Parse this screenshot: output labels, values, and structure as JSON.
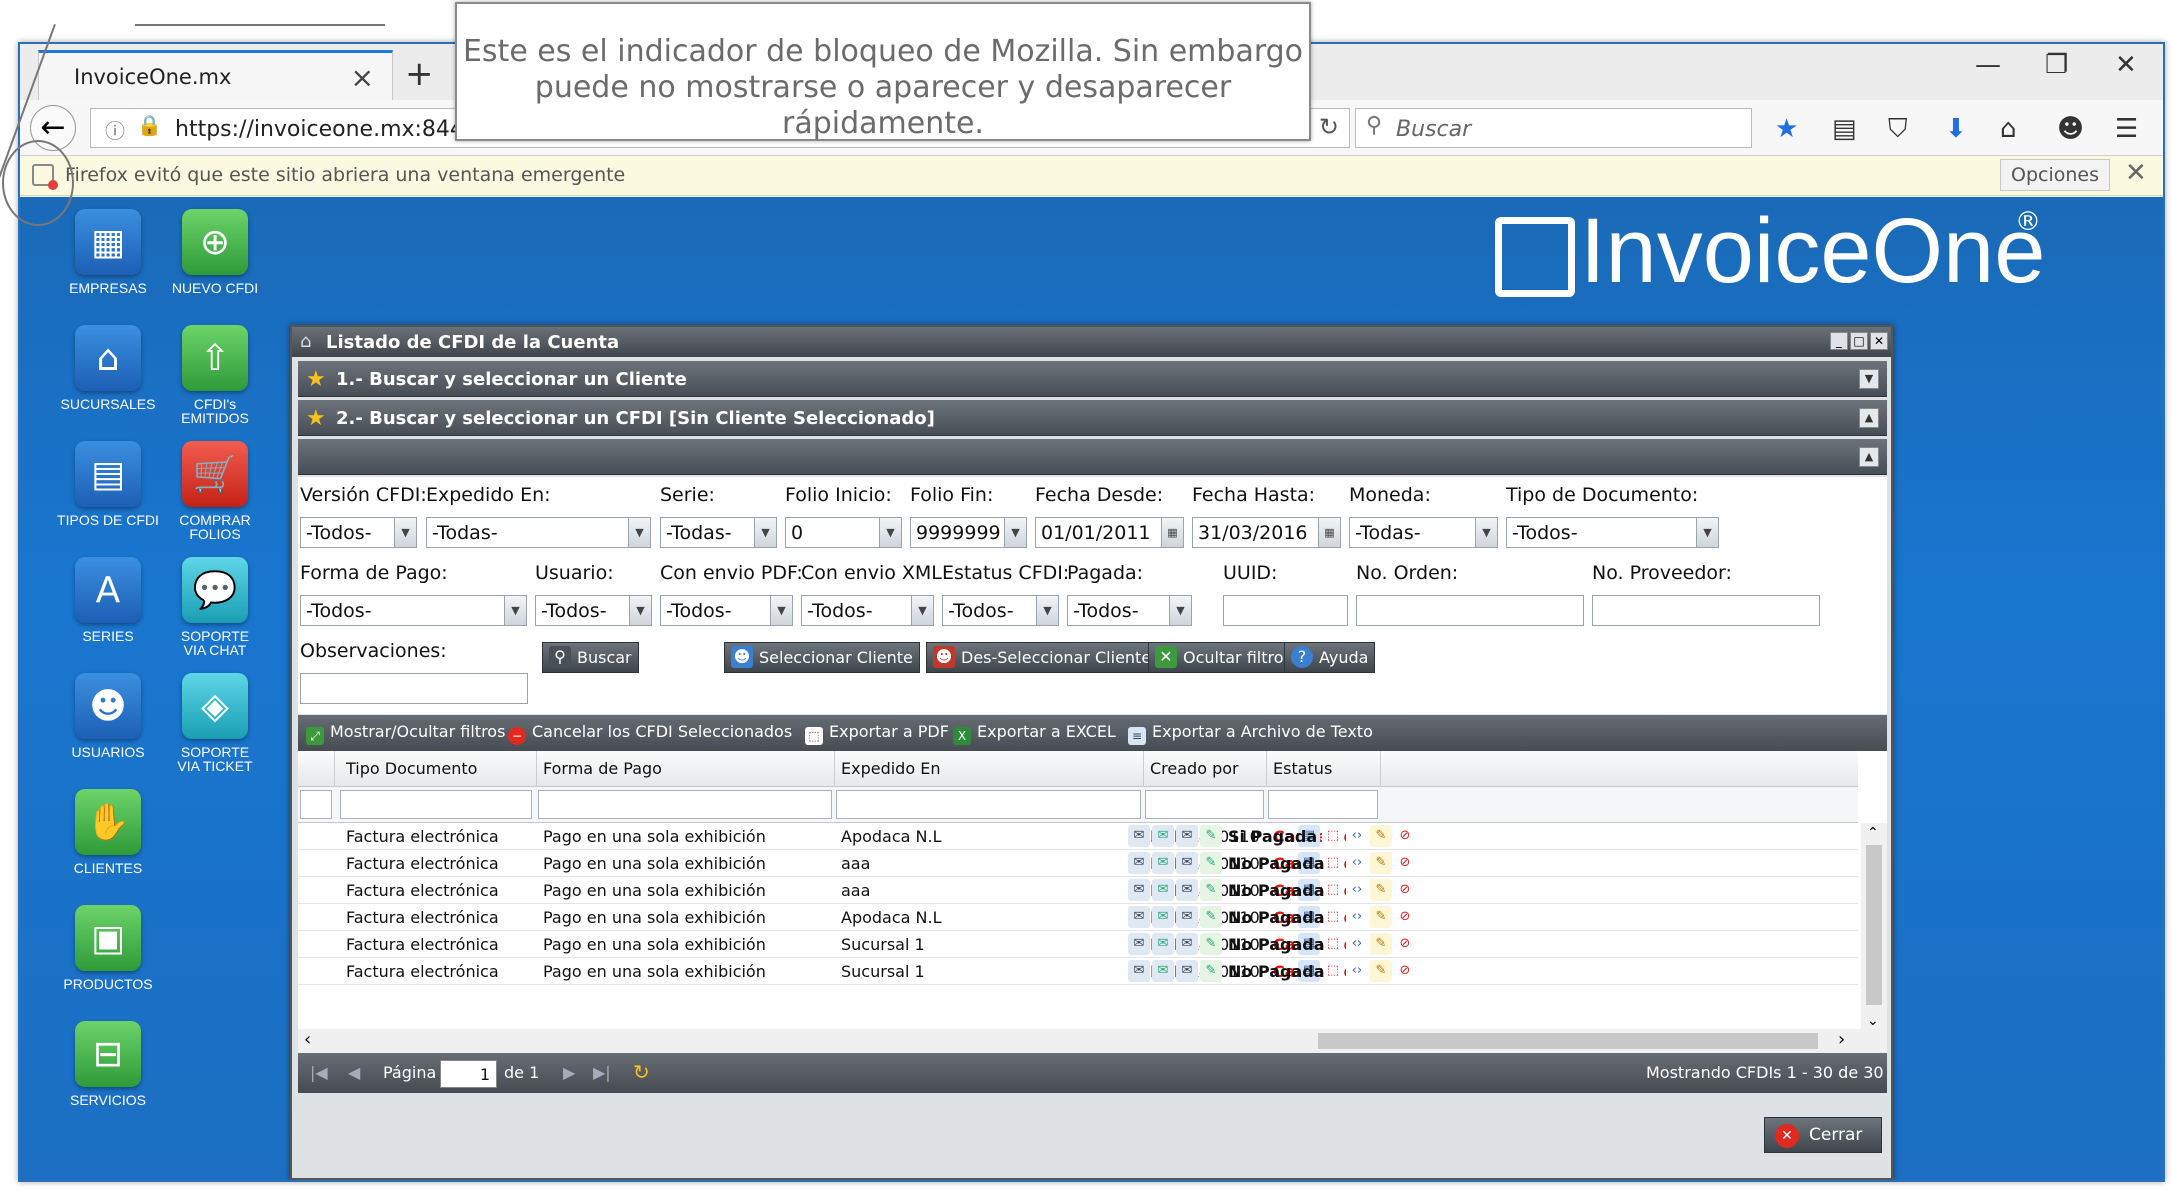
{
  "browser": {
    "tab_title": "InvoiceOne.mx",
    "url": "https://invoiceone.mx:8443/apl",
    "search_placeholder": "Buscar",
    "notification_text": "Firefox evitó que este sitio abriera una ventana emergente",
    "notification_options": "Opciones"
  },
  "annotation": {
    "line1": "Este es el indicador de bloqueo de Mozilla. Sin embargo",
    "line2": "puede no mostrarse o aparecer y desaparecer rápidamente."
  },
  "logo": {
    "text": "InvoiceOne",
    "reg": "®"
  },
  "desktop_icons": {
    "empresas": "EMPRESAS",
    "nuevo_cfdi": "NUEVO CFDI",
    "sucursales": "SUCURSALES",
    "cfdis_emitidos_1": "CFDI's",
    "cfdis_emitidos_2": "EMITIDOS",
    "tipos_cfdi": "TIPOS DE CFDI",
    "comprar_1": "COMPRAR",
    "comprar_2": "FOLIOS",
    "series": "SERIES",
    "soporte_chat_1": "SOPORTE",
    "soporte_chat_2": "VIA CHAT",
    "usuarios": "USUARIOS",
    "soporte_ticket_1": "SOPORTE",
    "soporte_ticket_2": "VIA TICKET",
    "clientes": "CLIENTES",
    "productos": "PRODUCTOS",
    "servicios": "SERVICIOS"
  },
  "window": {
    "title": "Listado de CFDI de la Cuenta",
    "panel1": "1.- Buscar y seleccionar un Cliente",
    "panel2": "2.- Buscar y seleccionar un CFDI [Sin Cliente Seleccionado]",
    "filters": {
      "version_lbl": "Versión CFDI:",
      "version_val": "-Todos-",
      "expedido_lbl": "Expedido En:",
      "expedido_val": "-Todas-",
      "serie_lbl": "Serie:",
      "serie_val": "-Todas-",
      "folio_ini_lbl": "Folio Inicio:",
      "folio_ini_val": "0",
      "folio_fin_lbl": "Folio Fin:",
      "folio_fin_val": "9999999",
      "fecha_desde_lbl": "Fecha Desde:",
      "fecha_desde_val": "01/01/2011",
      "fecha_hasta_lbl": "Fecha Hasta:",
      "fecha_hasta_val": "31/03/2016",
      "moneda_lbl": "Moneda:",
      "moneda_val": "-Todas-",
      "tipo_doc_lbl": "Tipo de Documento:",
      "tipo_doc_val": "-Todos-",
      "forma_pago_lbl": "Forma de Pago:",
      "forma_pago_val": "-Todos-",
      "usuario_lbl": "Usuario:",
      "usuario_val": "-Todos-",
      "envio_pdf_lbl": "Con envio PDF:",
      "envio_pdf_val": "-Todos-",
      "envio_xml_lbl": "Con envio XML:",
      "envio_xml_val": "-Todos-",
      "estatus_lbl": "Estatus CFDI:",
      "estatus_val": "-Todos-",
      "pagada_lbl": "Pagada:",
      "pagada_val": "-Todos-",
      "uuid_lbl": "UUID:",
      "orden_lbl": "No. Orden:",
      "proveedor_lbl": "No. Proveedor:",
      "observaciones_lbl": "Observaciones:"
    },
    "buttons": {
      "buscar": "Buscar",
      "seleccionar": "Seleccionar Cliente",
      "deseleccionar": "Des-Seleccionar Cliente",
      "ocultar": "Ocultar filtros",
      "ayuda": "Ayuda"
    },
    "toolbar": {
      "mostrar": "Mostrar/Ocultar filtros",
      "cancelar": "Cancelar los CFDI Seleccionados",
      "pdf": "Exportar a PDF",
      "excel": "Exportar a EXCEL",
      "texto": "Exportar a Archivo de Texto"
    },
    "columns": {
      "tipo": "Tipo Documento",
      "forma": "Forma de Pago",
      "expedido": "Expedido En",
      "creado": "Creado por",
      "estatus": "Estatus"
    },
    "rows": [
      {
        "tipo": "Factura electrónica",
        "forma": "Pago en una sola exhibición",
        "expedido": "Apodaca N.L",
        "creado": "MEMA840110",
        "estatus": "Cancelado",
        "pago": "Si Pagada"
      },
      {
        "tipo": "Factura electrónica",
        "forma": "Pago en una sola exhibición",
        "expedido": "aaa",
        "creado": "MEMA840110",
        "estatus": "Cancelado",
        "pago": "No Pagada"
      },
      {
        "tipo": "Factura electrónica",
        "forma": "Pago en una sola exhibición",
        "expedido": "aaa",
        "creado": "MEMA840110",
        "estatus": "Cancelado",
        "pago": "No Pagada"
      },
      {
        "tipo": "Factura electrónica",
        "forma": "Pago en una sola exhibición",
        "expedido": "Apodaca N.L",
        "creado": "MEMA840110",
        "estatus": "Cancelado",
        "pago": "No Pagada"
      },
      {
        "tipo": "Factura electrónica",
        "forma": "Pago en una sola exhibición",
        "expedido": "Sucursal 1",
        "creado": "MEMA840110",
        "estatus": "Cancelado",
        "pago": "No Pagada"
      },
      {
        "tipo": "Factura electrónica",
        "forma": "Pago en una sola exhibición",
        "expedido": "Sucursal 1",
        "creado": "MEMA840110",
        "estatus": "Cancelado",
        "pago": "No Pagada"
      }
    ],
    "pager": {
      "pagina": "Página",
      "page_value": "1",
      "de": "de 1",
      "mostrando": "Mostrando CFDIs 1 - 30 de 30"
    },
    "cerrar": "Cerrar"
  },
  "colors": {
    "cancel_red": "#e0180c",
    "app_blue": "#1976cf"
  }
}
